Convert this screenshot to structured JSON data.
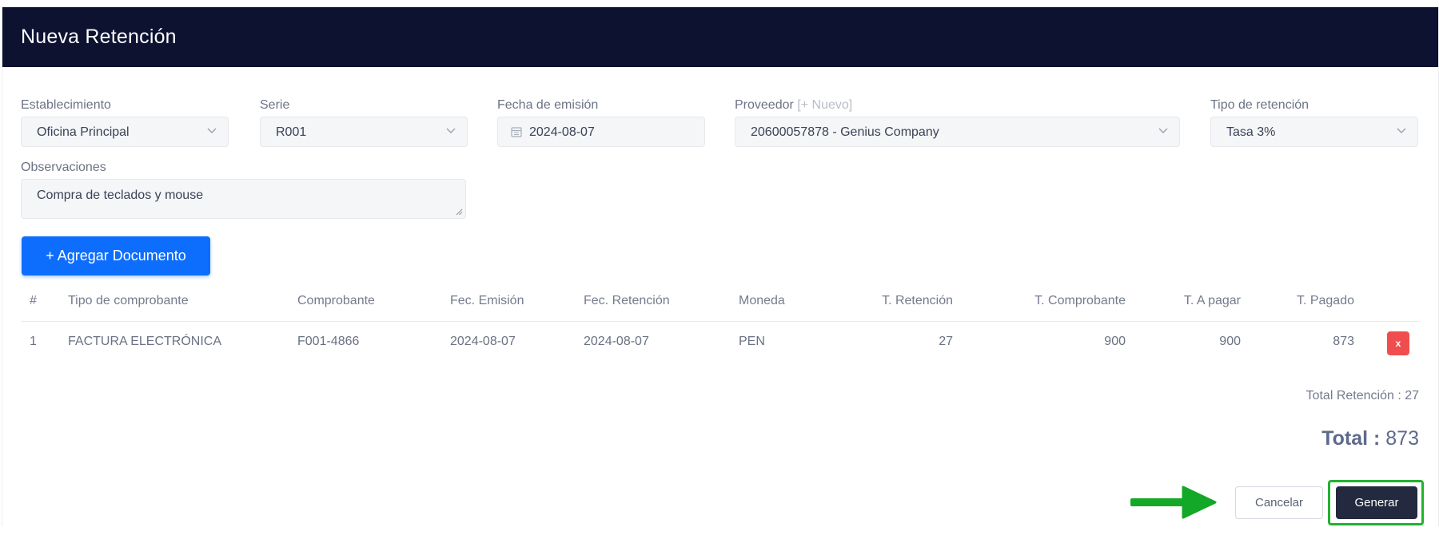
{
  "header": {
    "title": "Nueva Retención"
  },
  "form": {
    "establecimiento": {
      "label": "Establecimiento",
      "value": "Oficina Principal"
    },
    "serie": {
      "label": "Serie",
      "value": "R001"
    },
    "fecha": {
      "label": "Fecha de emisión",
      "value": "2024-08-07"
    },
    "proveedor": {
      "label": "Proveedor",
      "new_link": "[+ Nuevo]",
      "value": "20600057878 - Genius Company"
    },
    "tipo": {
      "label": "Tipo de retención",
      "value": "Tasa 3%"
    },
    "observaciones": {
      "label": "Observaciones",
      "value": "Compra de teclados y mouse"
    }
  },
  "add_document_label": "+ Agregar Documento",
  "table": {
    "headers": [
      "#",
      "Tipo de comprobante",
      "Comprobante",
      "Fec. Emisión",
      "Fec. Retención",
      "Moneda",
      "T. Retención",
      "T. Comprobante",
      "T. A pagar",
      "T. Pagado"
    ],
    "rows": [
      [
        "1",
        "FACTURA ELECTRÓNICA",
        "F001-4866",
        "2024-08-07",
        "2024-08-07",
        "PEN",
        "27",
        "900",
        "900",
        "873"
      ]
    ],
    "delete_label": "x"
  },
  "totals": {
    "retencion": "Total Retención : 27",
    "total_label": "Total :",
    "total_value": "873"
  },
  "actions": {
    "cancel": "Cancelar",
    "generate": "Generar"
  },
  "colors": {
    "header_bg": "#0c1230",
    "primary": "#0d6efd",
    "danger": "#f04e4e",
    "highlight": "#21b230",
    "dark_button": "#23293f"
  }
}
